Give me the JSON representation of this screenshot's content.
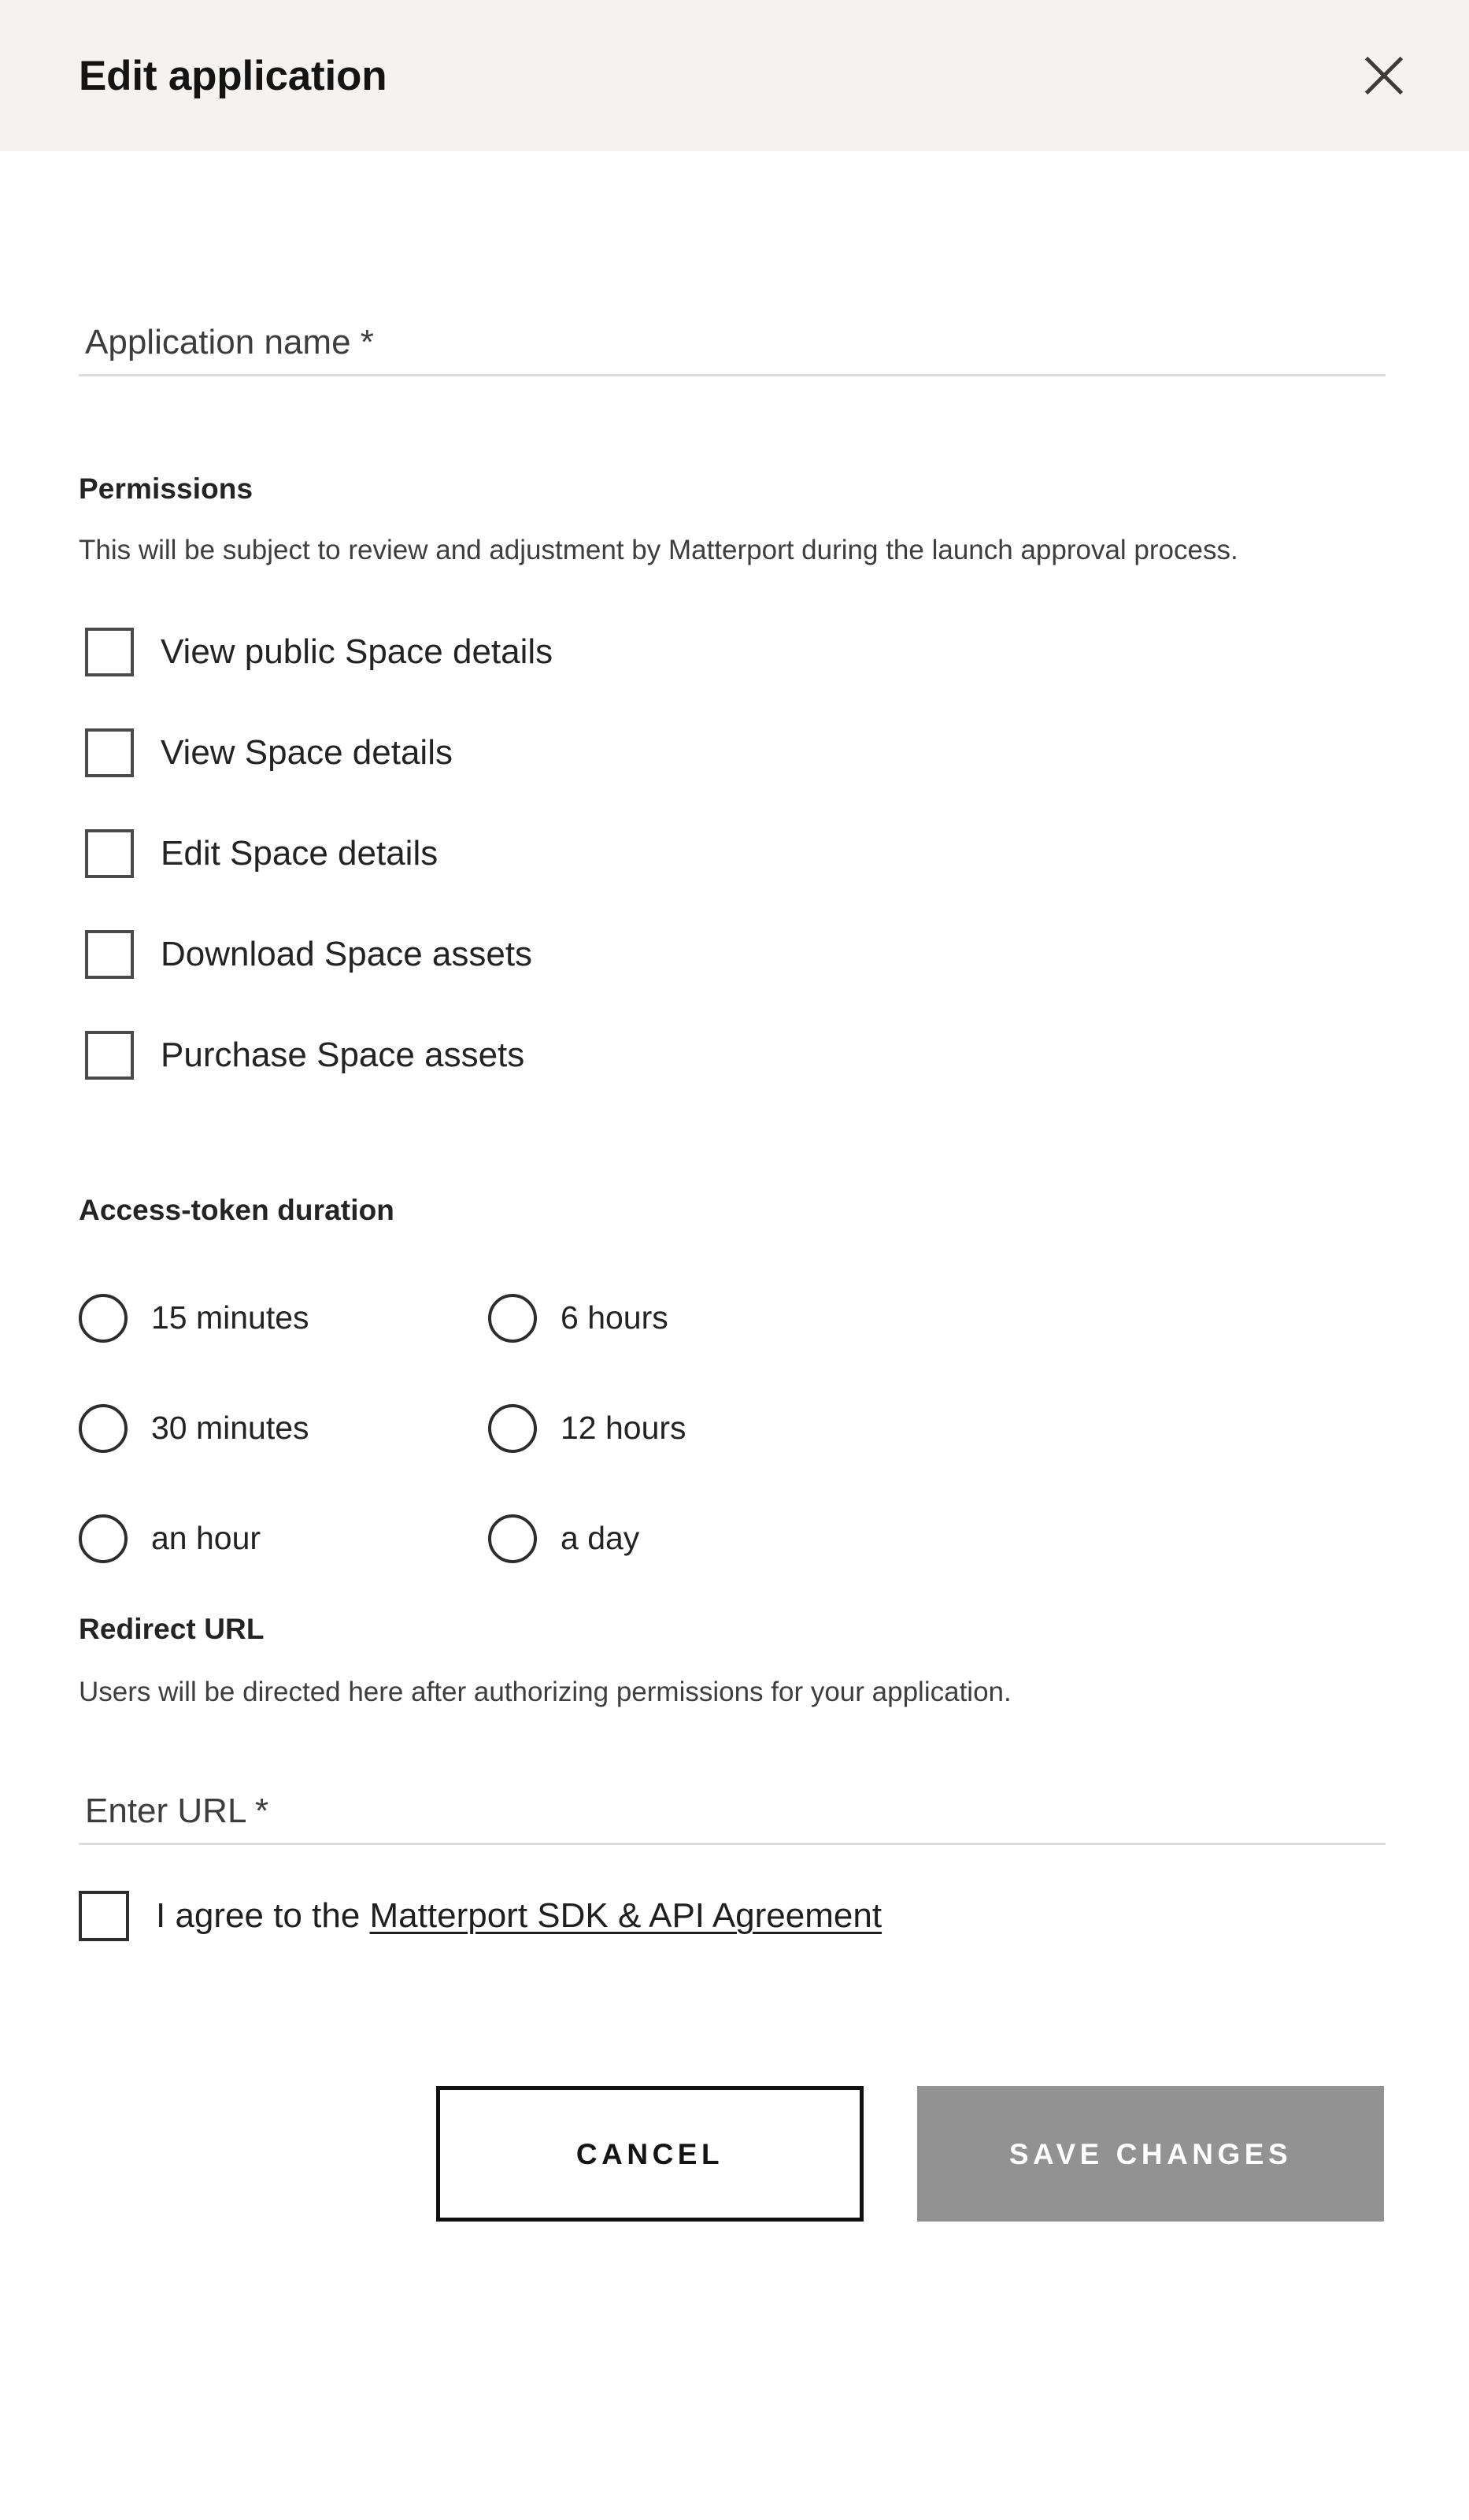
{
  "header": {
    "title": "Edit application",
    "close_icon": "close-icon"
  },
  "application_name_field": {
    "placeholder": "Application name *",
    "value": ""
  },
  "permissions": {
    "heading": "Permissions",
    "description": "This will be subject to review and adjustment by Matterport during the launch approval process.",
    "items": [
      {
        "label": "View public Space details",
        "checked": false
      },
      {
        "label": "View Space details",
        "checked": false
      },
      {
        "label": "Edit Space details",
        "checked": false
      },
      {
        "label": "Download Space assets",
        "checked": false
      },
      {
        "label": "Purchase Space assets",
        "checked": false
      }
    ]
  },
  "access_token": {
    "heading": "Access-token duration",
    "options": [
      {
        "label": "15 minutes",
        "selected": false
      },
      {
        "label": "6 hours",
        "selected": false
      },
      {
        "label": "30 minutes",
        "selected": false
      },
      {
        "label": "12 hours",
        "selected": false
      },
      {
        "label": "an hour",
        "selected": false
      },
      {
        "label": "a day",
        "selected": false
      }
    ]
  },
  "redirect_url": {
    "heading": "Redirect URL",
    "description": "Users will be directed here after authorizing permissions for your application.",
    "field": {
      "placeholder": "Enter URL *",
      "value": ""
    }
  },
  "agreement": {
    "checked": false,
    "prefix": "I agree to the ",
    "link_text": "Matterport SDK & API Agreement"
  },
  "footer": {
    "cancel_label": "CANCEL",
    "save_label": "SAVE CHANGES",
    "save_disabled": true
  },
  "colors": {
    "header_bg": "#f4f3f1",
    "body_bg": "#ffffff",
    "text": "#1f1f1f",
    "muted_text": "#3e3e3e",
    "field_underline": "#dedddb",
    "control_border": "#2d2d2d",
    "save_disabled_bg": "#929292",
    "cancel_border": "#111111"
  }
}
